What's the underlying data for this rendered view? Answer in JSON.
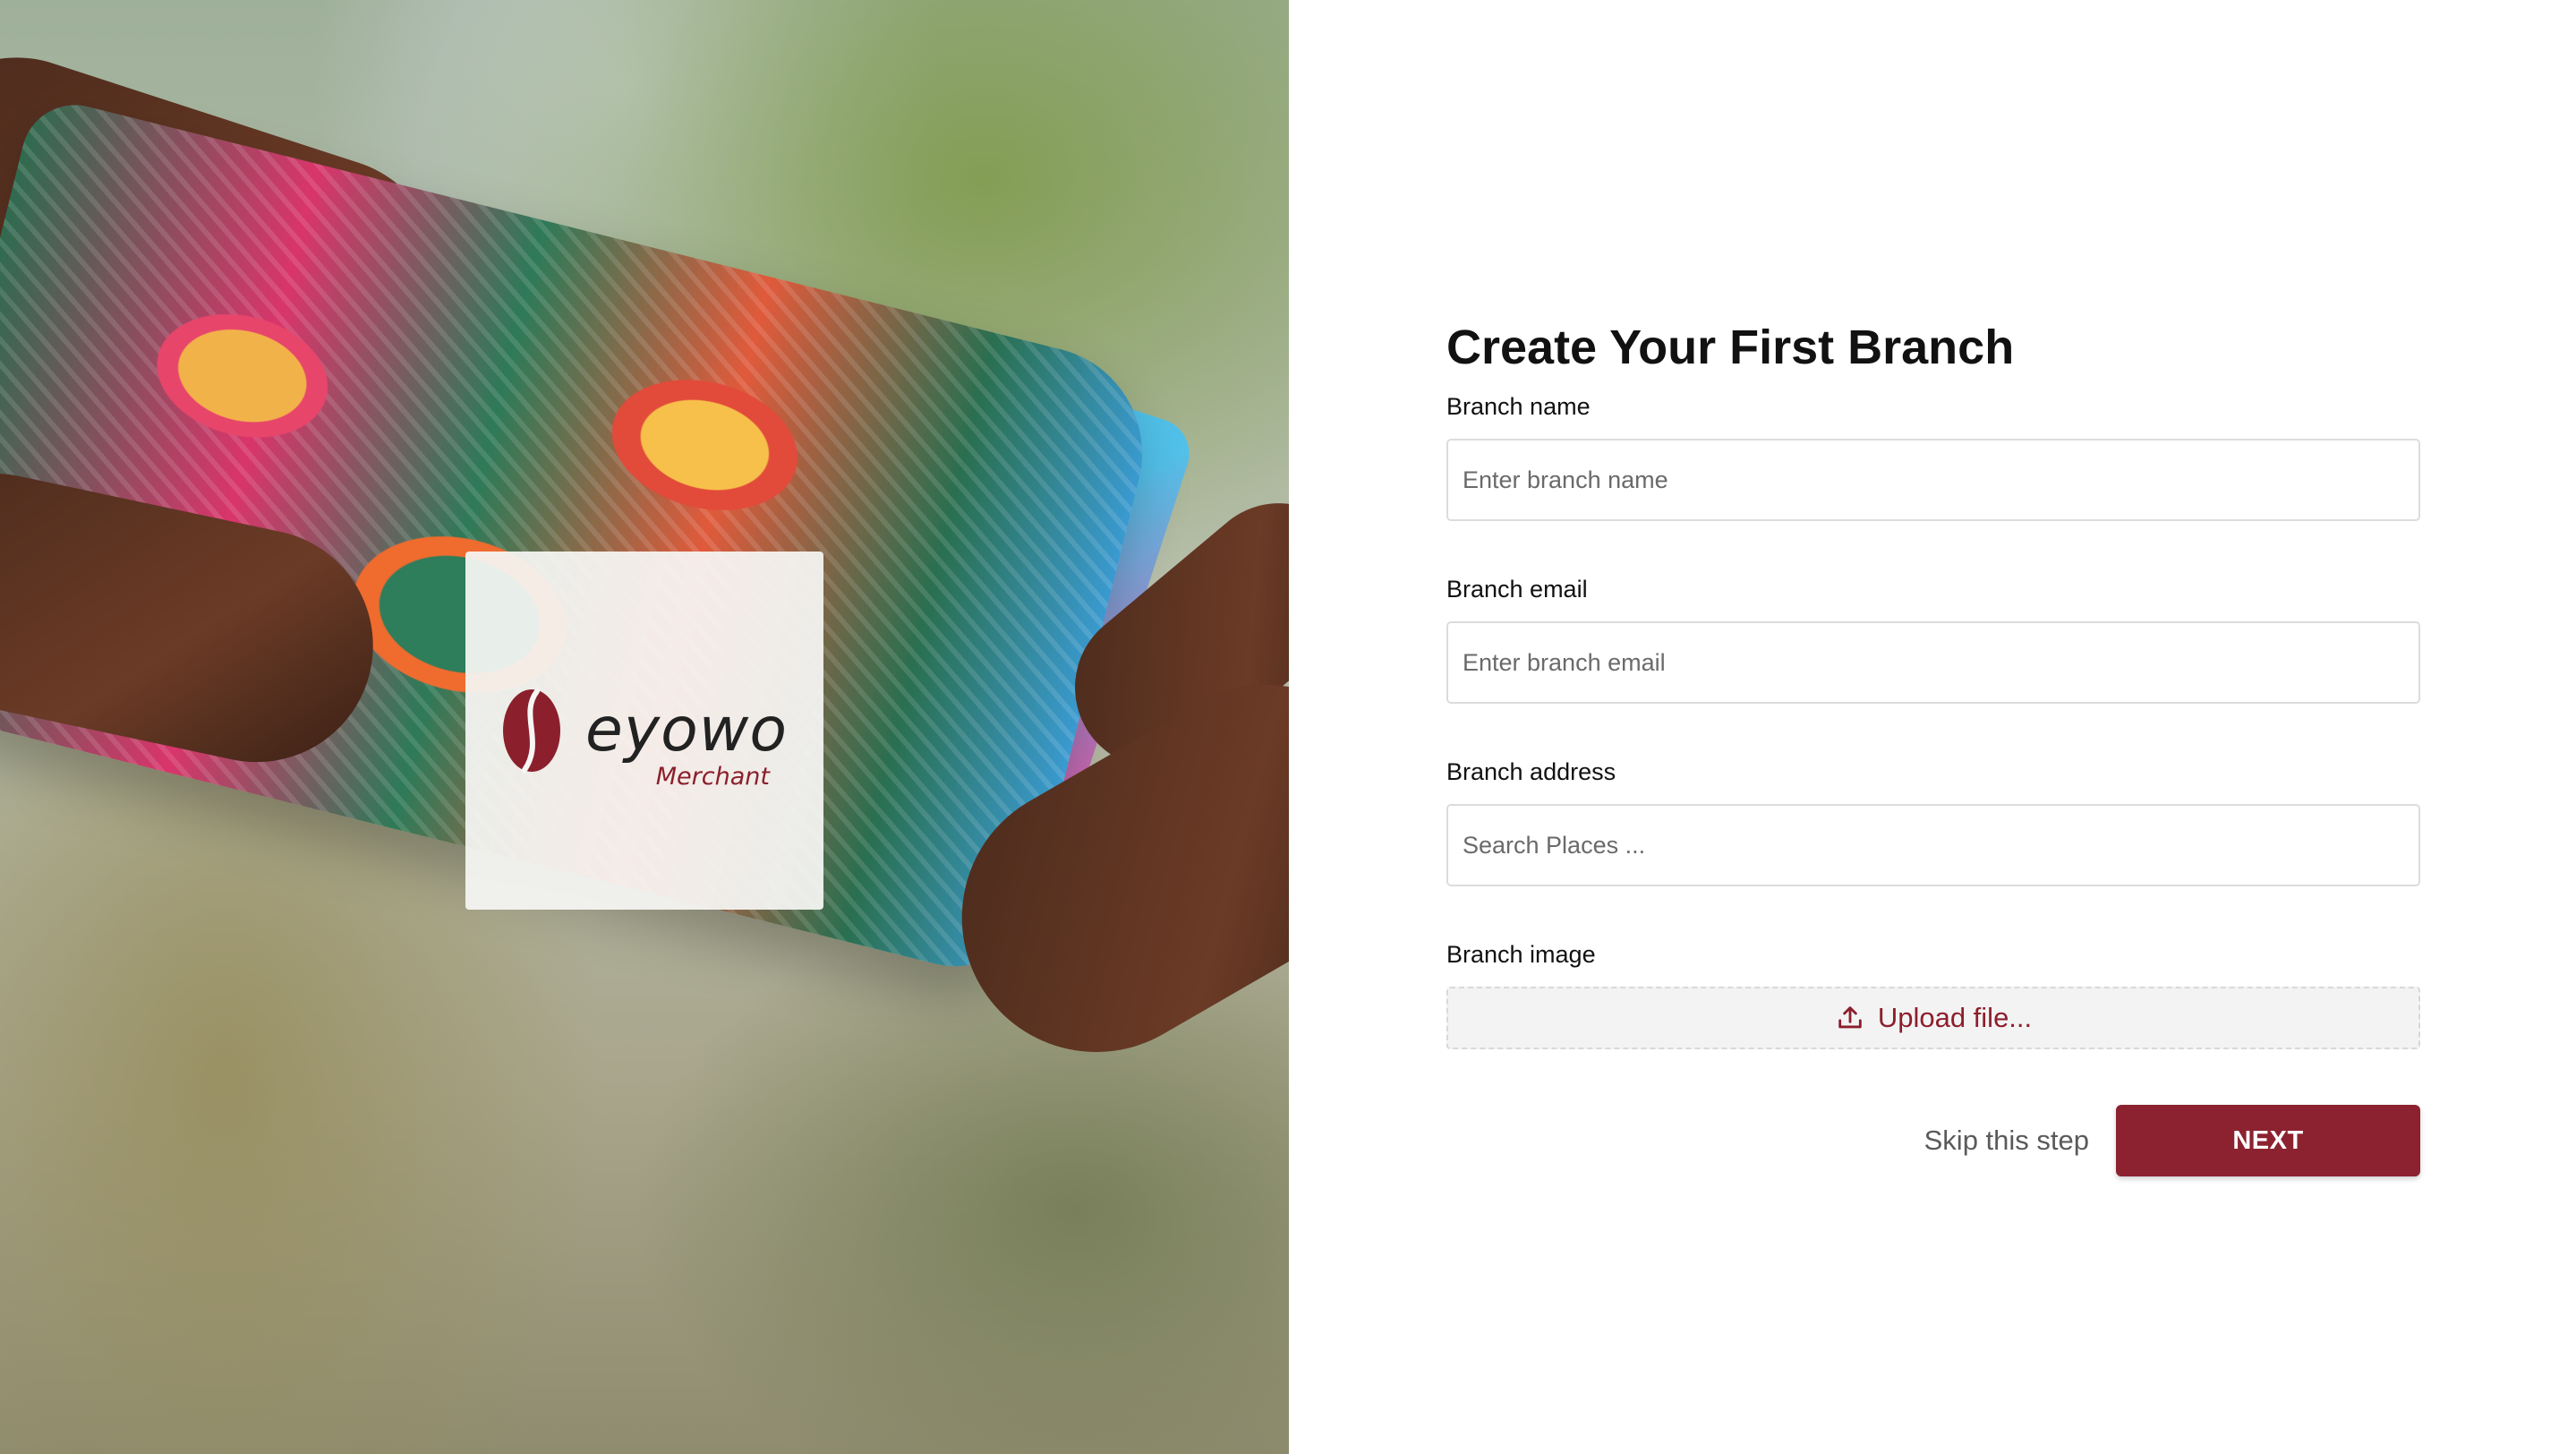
{
  "brand": {
    "name": "eyowo",
    "subtitle": "Merchant",
    "accent_color": "#8c2230"
  },
  "form": {
    "title": "Create Your First Branch",
    "fields": {
      "name": {
        "label": "Branch name",
        "placeholder": "Enter branch name",
        "value": ""
      },
      "email": {
        "label": "Branch email",
        "placeholder": "Enter branch email",
        "value": ""
      },
      "address": {
        "label": "Branch address",
        "placeholder": "Search Places ...",
        "value": ""
      },
      "image": {
        "label": "Branch image",
        "upload_label": "Upload file...",
        "icon": "upload-icon"
      }
    },
    "actions": {
      "skip_label": "Skip this step",
      "next_label": "NEXT"
    }
  }
}
